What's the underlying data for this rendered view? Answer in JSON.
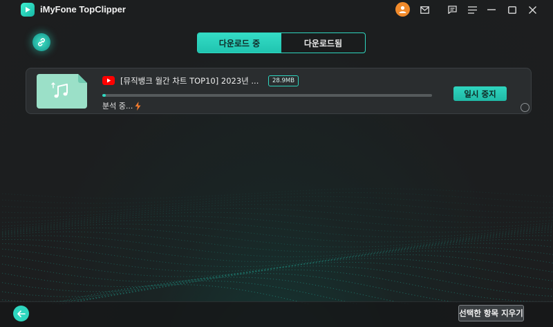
{
  "app": {
    "title": "iMyFone TopClipper"
  },
  "titlebar": {
    "icons": [
      "user-avatar-icon",
      "mail-icon",
      "feedback-icon",
      "menu-icon",
      "minimize-icon",
      "maximize-icon",
      "close-icon"
    ]
  },
  "tabs": [
    {
      "label": "다운로드 중",
      "active": true
    },
    {
      "label": "다운로드됨",
      "active": false
    }
  ],
  "download": {
    "title": "[뮤직뱅크 월간 차트 TOP10] 2023년 ...",
    "size": "28.9MB",
    "progress": 0.01,
    "status": "분석 중...",
    "pause_label": "일시 중지",
    "source_icon": "youtube-icon",
    "thumb_icon": "music-file-icon"
  },
  "footer": {
    "clear_label": "선택한 항목 지우기"
  },
  "colors": {
    "accent": "#2fd7c0",
    "background": "#1d1e1f",
    "card": "#2a2d2f",
    "avatar": "#f08a2b",
    "youtube": "#ff0000",
    "analyzing": "#f07a2e"
  }
}
